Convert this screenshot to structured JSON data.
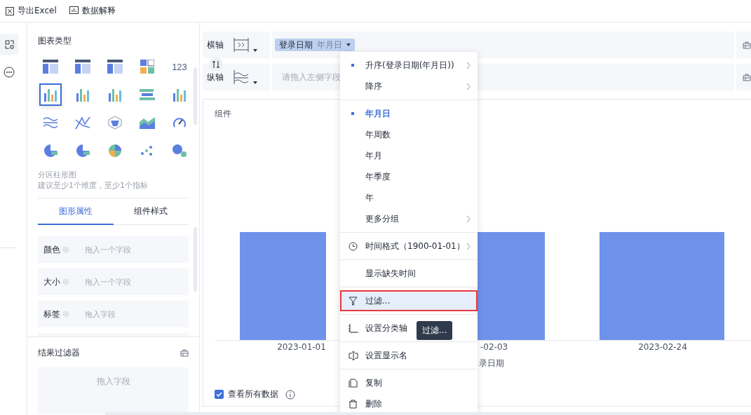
{
  "toolbar": {
    "buttons": [
      {
        "label": "导出Excel",
        "kind": "excel"
      },
      {
        "label": "数据解释",
        "kind": "explain"
      }
    ]
  },
  "panel": {
    "title": "图表类型",
    "chart_types": [
      {
        "kind": "table",
        "selected": false
      },
      {
        "kind": "table",
        "selected": false
      },
      {
        "kind": "table",
        "selected": false
      },
      {
        "kind": "tiles",
        "selected": false
      },
      {
        "kind": "number",
        "label": "123",
        "selected": false
      },
      {
        "kind": "bars",
        "selected": true
      },
      {
        "kind": "bars",
        "selected": false
      },
      {
        "kind": "bars",
        "selected": false
      },
      {
        "kind": "hbars",
        "selected": false
      },
      {
        "kind": "bars",
        "selected": false
      },
      {
        "kind": "waves",
        "selected": false
      },
      {
        "kind": "lines",
        "selected": false
      },
      {
        "kind": "radar",
        "selected": false
      },
      {
        "kind": "area",
        "selected": false
      },
      {
        "kind": "gauge",
        "selected": false
      },
      {
        "kind": "pie",
        "selected": false
      },
      {
        "kind": "pie",
        "selected": false
      },
      {
        "kind": "globe",
        "selected": false
      },
      {
        "kind": "dots",
        "selected": false
      },
      {
        "kind": "bubble",
        "selected": false
      }
    ],
    "description": {
      "name": "分区柱形图",
      "hint": "建议至少1个维度，至少1个指标"
    },
    "tabs": [
      {
        "label": "图形属性",
        "selected": true
      },
      {
        "label": "组件样式",
        "selected": false
      }
    ],
    "properties": [
      {
        "label": "颜色",
        "placeholder": "拖入一个字段"
      },
      {
        "label": "大小",
        "placeholder": "拖入一个字段"
      },
      {
        "label": "标签",
        "placeholder": "拖入字段"
      }
    ],
    "result_filter": {
      "title": "结果过滤器",
      "placeholder": "拖入字段"
    }
  },
  "axes": [
    {
      "label": "横轴",
      "field": {
        "name": "登录日期",
        "group": "年月日"
      }
    },
    {
      "label": "纵轴",
      "placeholder": "请拖入左侧字段"
    }
  ],
  "chart": {
    "title": "组件",
    "x_labels": [
      "2023-01-01",
      "-02-03",
      "2023-02-24"
    ],
    "axis_title": "录日期",
    "show_all": {
      "label": "查看所有数据",
      "checked": true
    }
  },
  "menu": {
    "sections": [
      {
        "kind": "sort",
        "items": [
          {
            "label": "升序(登录日期(年月日))",
            "selected": true,
            "submenu": true,
            "kind": "plain"
          },
          {
            "label": "降序",
            "selected": false,
            "submenu": true,
            "kind": "plain"
          }
        ]
      },
      {
        "kind": "group",
        "items": [
          {
            "label": "年月日",
            "selected": true,
            "submenu": false,
            "kind": "plain"
          },
          {
            "label": "年周数",
            "selected": false,
            "submenu": false,
            "kind": "plain"
          },
          {
            "label": "年月",
            "selected": false,
            "submenu": false,
            "kind": "plain"
          },
          {
            "label": "年季度",
            "selected": false,
            "submenu": false,
            "kind": "plain"
          },
          {
            "label": "年",
            "selected": false,
            "submenu": false,
            "kind": "plain"
          },
          {
            "label": "更多分组",
            "selected": false,
            "submenu": true,
            "kind": "plain"
          }
        ]
      },
      {
        "kind": "action",
        "items": [
          {
            "label": "时间格式（1900-01-01）",
            "selected": false,
            "submenu": true,
            "kind": "clock"
          }
        ]
      },
      {
        "kind": "action",
        "items": [
          {
            "label": "显示缺失时间",
            "selected": false,
            "submenu": false,
            "kind": "plain"
          }
        ]
      },
      {
        "kind": "action",
        "items": [
          {
            "label": "过滤...",
            "selected": false,
            "submenu": false,
            "kind": "filter",
            "highlighted": true
          }
        ]
      },
      {
        "kind": "action",
        "items": [
          {
            "label": "设置分类轴",
            "selected": false,
            "submenu": false,
            "kind": "axis"
          }
        ]
      },
      {
        "kind": "action",
        "items": [
          {
            "label": "设置显示名",
            "selected": false,
            "submenu": false,
            "kind": "rename"
          }
        ]
      },
      {
        "kind": "action",
        "items": [
          {
            "label": "复制",
            "selected": false,
            "submenu": false,
            "kind": "copy"
          },
          {
            "label": "删除",
            "selected": false,
            "submenu": false,
            "kind": "delete"
          }
        ]
      }
    ]
  },
  "tooltip": "过滤..."
}
